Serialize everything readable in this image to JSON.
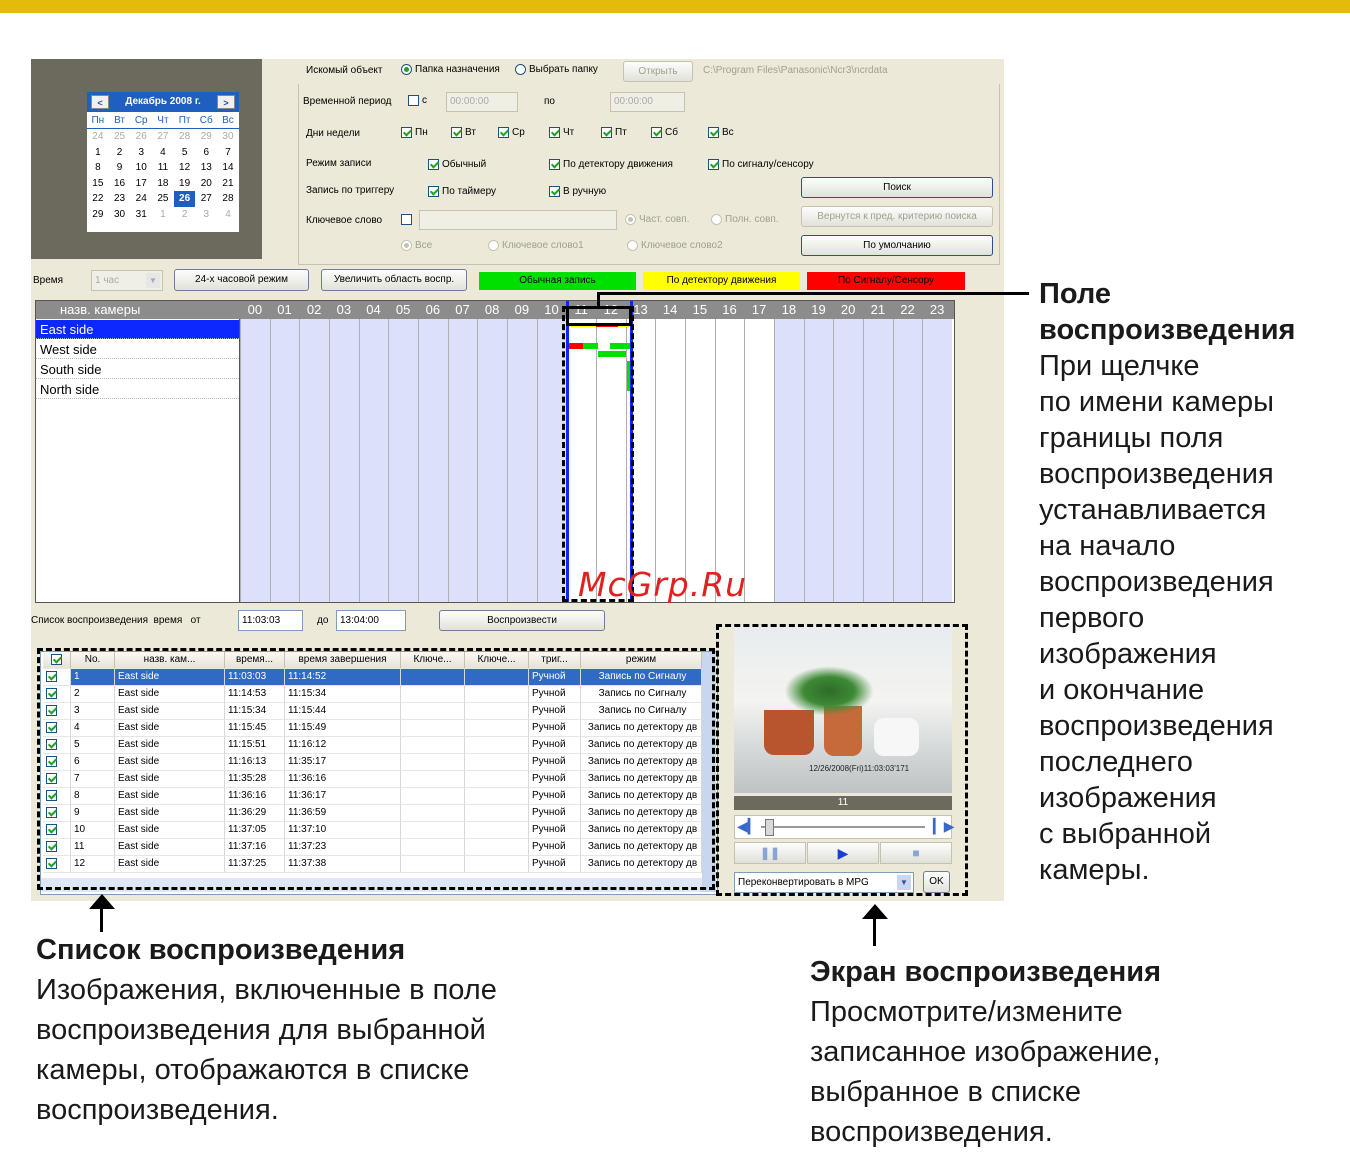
{
  "calendar": {
    "month_label": "Декабрь 2008 г.",
    "prev": "<",
    "next": ">",
    "day_names": [
      "Пн",
      "Вт",
      "Ср",
      "Чт",
      "Пт",
      "Сб",
      "Вс"
    ],
    "weeks": [
      [
        "24",
        "25",
        "26",
        "27",
        "28",
        "29",
        "30"
      ],
      [
        "1",
        "2",
        "3",
        "4",
        "5",
        "6",
        "7"
      ],
      [
        "8",
        "9",
        "10",
        "11",
        "12",
        "13",
        "14"
      ],
      [
        "15",
        "16",
        "17",
        "18",
        "19",
        "20",
        "21"
      ],
      [
        "22",
        "23",
        "24",
        "25",
        "26",
        "27",
        "28"
      ],
      [
        "29",
        "30",
        "31",
        "1",
        "2",
        "3",
        "4"
      ]
    ],
    "selected_day": "26"
  },
  "search": {
    "target_label": "Искомый объект",
    "folder_dest": "Папка назначения",
    "choose_folder": "Выбрать папку",
    "open_btn": "Открыть",
    "path": "C:\\Program Files\\Panasonic\\Ncr3\\ncrdata",
    "period_label": "Временной период",
    "from_label": "с",
    "from_time": "00:00:00",
    "to_label": "по",
    "to_time": "00:00:00",
    "weekdays_label": "Дни недели",
    "weekdays": [
      "Пн",
      "Вт",
      "Ср",
      "Чт",
      "Пт",
      "Сб",
      "Вс"
    ],
    "rec_mode_label": "Режим записи",
    "mode_normal": "Обычный",
    "mode_motion": "По детектору движения",
    "mode_sensor": "По сигналу/сенсору",
    "trigger_label": "Запись по триггеру",
    "trig_timer": "По таймеру",
    "trig_manual": "В ручную",
    "keyword_label": "Ключевое слово",
    "partial": "Част. совп.",
    "full": "Полн. совп.",
    "all": "Все",
    "kw1": "Ключевое слово1",
    "kw2": "Ключевое слово2",
    "search_btn": "Поиск",
    "back_btn": "Вернутся к пред. критерию поиска",
    "default_btn": "По умолчанию"
  },
  "toolbar": {
    "time_label": "Время",
    "time_value": "1 час",
    "mode24_btn": "24-х часовой режим",
    "enlarge_btn": "Увеличить область воспр.",
    "legend_normal": "Обычная запись",
    "legend_motion": "По детектору движения",
    "legend_sensor": "По Сигналу/Сенсору",
    "color_normal": "#00e000",
    "color_motion": "#ffff00",
    "color_sensor": "#ff0000"
  },
  "timeline": {
    "camera_header": "назв. камеры",
    "hours": [
      "00",
      "01",
      "02",
      "03",
      "04",
      "05",
      "06",
      "07",
      "08",
      "09",
      "10",
      "11",
      "12",
      "13",
      "14",
      "15",
      "16",
      "17",
      "18",
      "19",
      "20",
      "21",
      "22",
      "23"
    ],
    "cameras": [
      "East side",
      "West side",
      "South side",
      "North side"
    ]
  },
  "playlist": {
    "label": "Список воспроизведения",
    "time_label": "время",
    "from_label": "от",
    "from_time": "11:03:03",
    "to_label": "до",
    "to_time": "13:04:00",
    "play_btn": "Воспроизвести",
    "columns": [
      "No.",
      "назв. кам...",
      "время...",
      "время завершения",
      "Ключе...",
      "Ключе...",
      "триг...",
      "режим"
    ],
    "rows": [
      [
        "1",
        "East side",
        "11:03:03",
        "11:14:52",
        "",
        "",
        "Ручной",
        "Запись по Сигналу"
      ],
      [
        "2",
        "East side",
        "11:14:53",
        "11:15:34",
        "",
        "",
        "Ручной",
        "Запись по Сигналу"
      ],
      [
        "3",
        "East side",
        "11:15:34",
        "11:15:44",
        "",
        "",
        "Ручной",
        "Запись по Сигналу"
      ],
      [
        "4",
        "East side",
        "11:15:45",
        "11:15:49",
        "",
        "",
        "Ручной",
        "Запись по детектору дв"
      ],
      [
        "5",
        "East side",
        "11:15:51",
        "11:16:12",
        "",
        "",
        "Ручной",
        "Запись по детектору дв"
      ],
      [
        "6",
        "East side",
        "11:16:13",
        "11:35:17",
        "",
        "",
        "Ручной",
        "Запись по детектору дв"
      ],
      [
        "7",
        "East side",
        "11:35:28",
        "11:36:16",
        "",
        "",
        "Ручной",
        "Запись по детектору дв"
      ],
      [
        "8",
        "East side",
        "11:36:16",
        "11:36:17",
        "",
        "",
        "Ручной",
        "Запись по детектору дв"
      ],
      [
        "9",
        "East side",
        "11:36:29",
        "11:36:59",
        "",
        "",
        "Ручной",
        "Запись по детектору дв"
      ],
      [
        "10",
        "East side",
        "11:37:05",
        "11:37:10",
        "",
        "",
        "Ручной",
        "Запись по детектору дв"
      ],
      [
        "11",
        "East side",
        "11:37:16",
        "11:37:23",
        "",
        "",
        "Ручной",
        "Запись по детектору дв"
      ],
      [
        "12",
        "East side",
        "11:37:25",
        "11:37:38",
        "",
        "",
        "Ручной",
        "Запись по детектору дв"
      ]
    ]
  },
  "player": {
    "timestamp": "12/26/2008(Fri)11:03:03'171",
    "frame_no": "11",
    "convert_option": "Переконвертировать в MPG",
    "ok_btn": "OK"
  },
  "annotations": {
    "field_title_1": "Поле",
    "field_title_2": "воспроизведения",
    "field_lines": [
      "При щелчке",
      "по имени камеры",
      "границы поля",
      "воспроизведения",
      "устанавливается",
      "на начало",
      "воспроизведения",
      "первого",
      "изображения",
      "и окончание",
      "воспроизведения",
      "последнего",
      "изображения",
      "с выбранной",
      "камеры."
    ],
    "list_title": "Список воспроизведения",
    "list_lines": [
      "Изображения, включенные в поле",
      "воспроизведения для выбранной",
      "камеры, отображаются в списке",
      "воспроизведения."
    ],
    "screen_title": "Экран воспроизведения",
    "screen_lines": [
      "Просмотрите/измените",
      "записанное изображение,",
      "выбранное в списке",
      "воспроизведения."
    ]
  },
  "watermark": "McGrp.Ru"
}
